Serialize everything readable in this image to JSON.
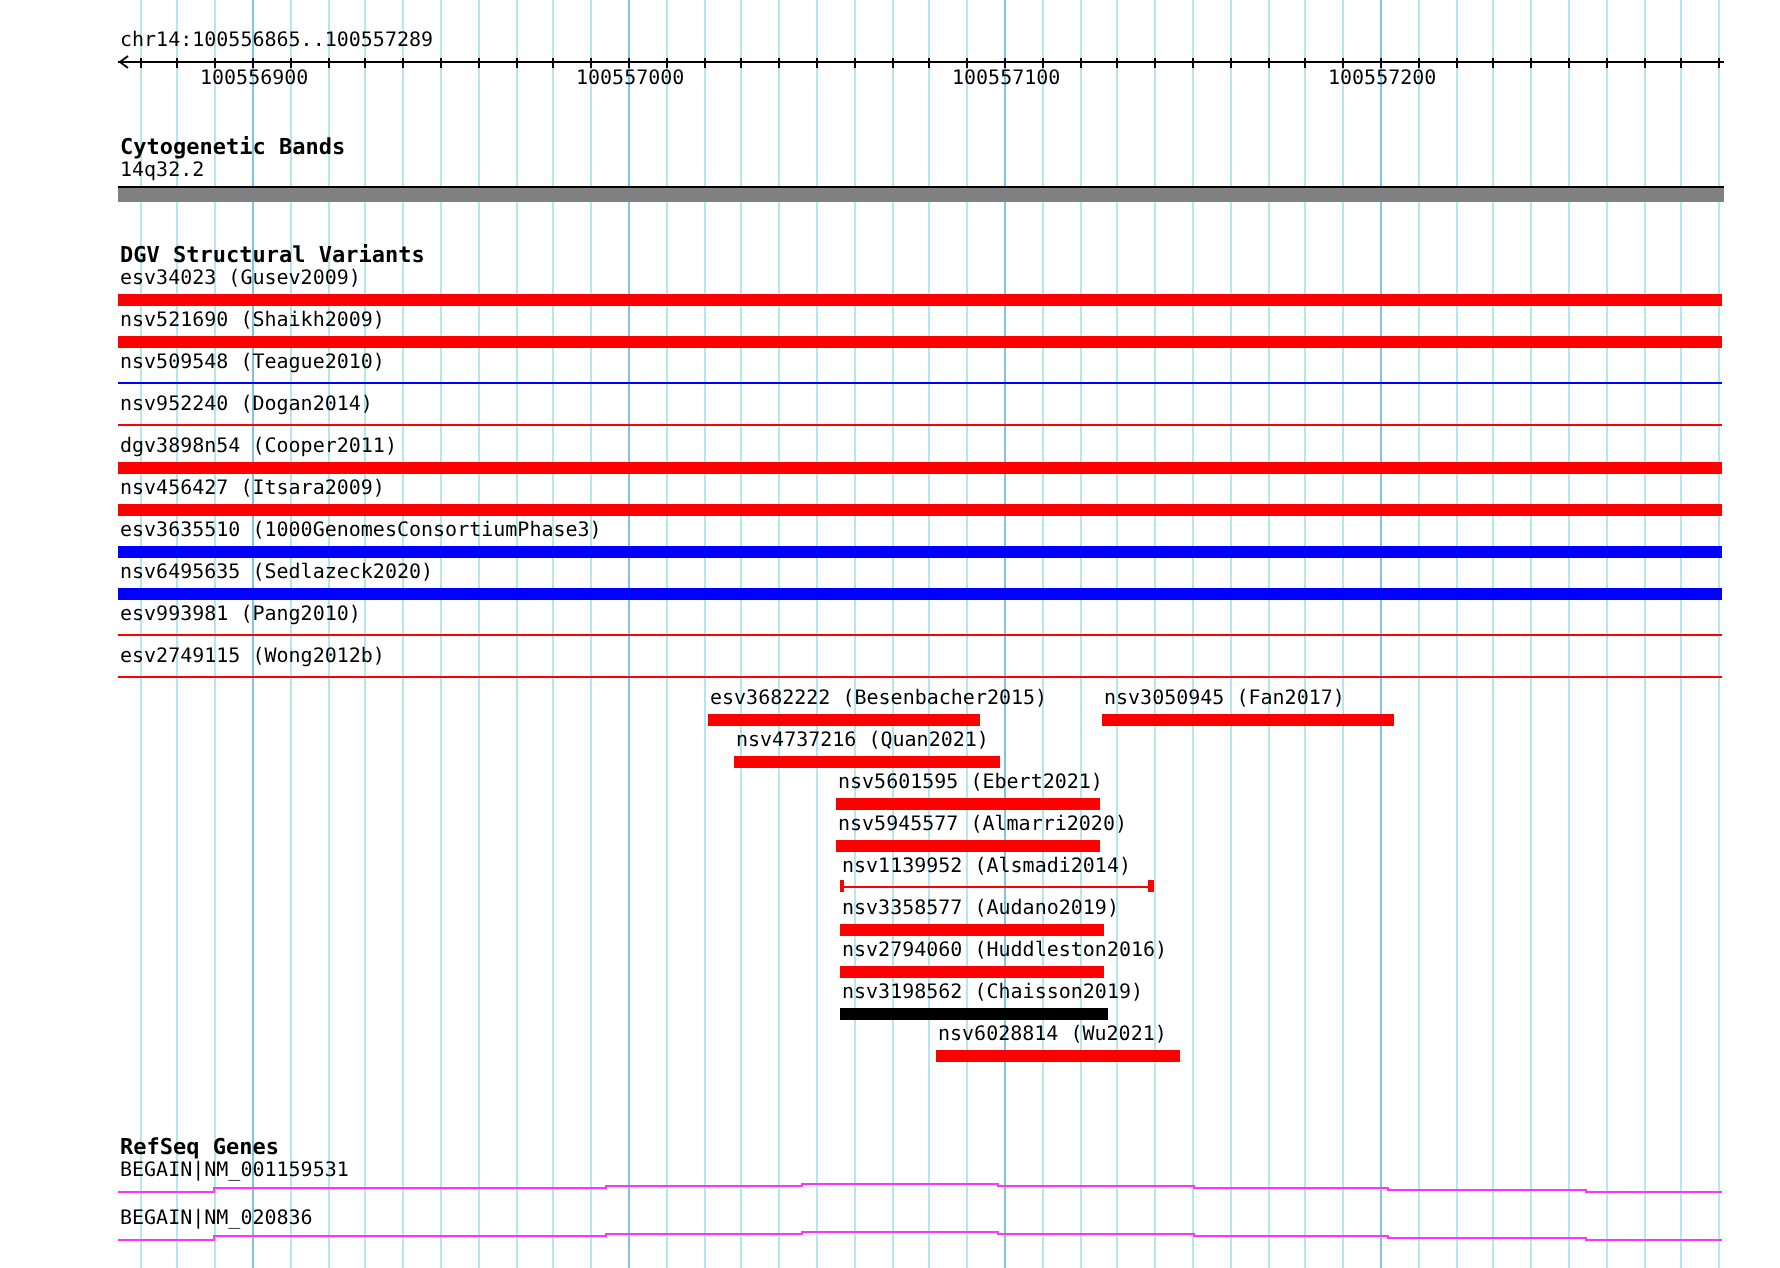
{
  "ruler": {
    "location": "chr14:100556865..100557289",
    "ticks": [
      "100556900",
      "100557000",
      "100557100",
      "100557200"
    ]
  },
  "cytogenetic_bands": {
    "title": "Cytogenetic Bands",
    "band": {
      "label": "14q32.2",
      "color": "#808080"
    }
  },
  "dgv_structural_variants": {
    "title": "DGV Structural Variants",
    "variants": [
      {
        "label": "esv34023 (Gusev2009)",
        "color": "#ff0000",
        "kind": "bar"
      },
      {
        "label": "nsv521690 (Shaikh2009)",
        "color": "#ff0000",
        "kind": "bar"
      },
      {
        "label": "nsv509548 (Teague2010)",
        "color": "#0000ff",
        "kind": "line"
      },
      {
        "label": "nsv952240 (Dogan2014)",
        "color": "#ff0000",
        "kind": "line"
      },
      {
        "label": "dgv3898n54 (Cooper2011)",
        "color": "#ff0000",
        "kind": "bar"
      },
      {
        "label": "nsv456427 (Itsara2009)",
        "color": "#ff0000",
        "kind": "bar"
      },
      {
        "label": "esv3635510 (1000GenomesConsortiumPhase3)",
        "color": "#0000ff",
        "kind": "bar"
      },
      {
        "label": "nsv6495635 (Sedlazeck2020)",
        "color": "#0000ff",
        "kind": "bar"
      },
      {
        "label": "esv993981 (Pang2010)",
        "color": "#ff0000",
        "kind": "line"
      },
      {
        "label": "esv2749115 (Wong2012b)",
        "color": "#ff0000",
        "kind": "line"
      },
      {
        "label": "esv3682222 (Besenbacher2015)",
        "color": "#ff0000",
        "kind": "bar"
      },
      {
        "label": "nsv3050945 (Fan2017)",
        "color": "#ff0000",
        "kind": "bar"
      },
      {
        "label": "nsv4737216 (Quan2021)",
        "color": "#ff0000",
        "kind": "bar"
      },
      {
        "label": "nsv5601595 (Ebert2021)",
        "color": "#ff0000",
        "kind": "bar"
      },
      {
        "label": "nsv5945577 (Almarri2020)",
        "color": "#ff0000",
        "kind": "bar"
      },
      {
        "label": "nsv1139952 (Alsmadi2014)",
        "color": "#ff0000",
        "kind": "capped"
      },
      {
        "label": "nsv3358577 (Audano2019)",
        "color": "#ff0000",
        "kind": "bar"
      },
      {
        "label": "nsv2794060 (Huddleston2016)",
        "color": "#ff0000",
        "kind": "bar"
      },
      {
        "label": "nsv3198562 (Chaisson2019)",
        "color": "#000000",
        "kind": "bar"
      },
      {
        "label": "nsv6028814 (Wu2021)",
        "color": "#ff0000",
        "kind": "bar"
      }
    ]
  },
  "refseq_genes": {
    "title": "RefSeq Genes",
    "transcripts": [
      {
        "label": "BEGAIN|NM_001159531"
      },
      {
        "label": "BEGAIN|NM_020836"
      }
    ]
  }
}
